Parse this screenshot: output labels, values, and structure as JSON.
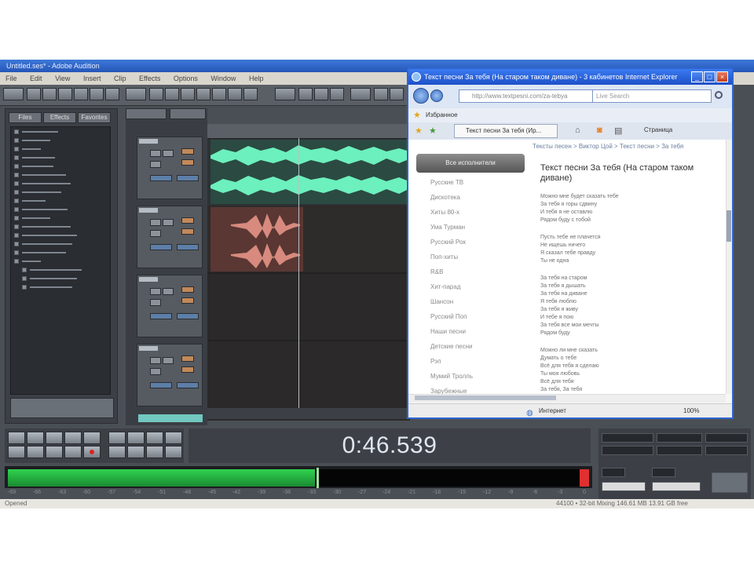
{
  "daw": {
    "title": "Untitled.ses* - Adobe Audition",
    "menu": [
      "File",
      "Edit",
      "View",
      "Insert",
      "Clip",
      "Effects",
      "Options",
      "Window",
      "Help"
    ],
    "organizer_tabs": [
      "Files",
      "Effects",
      "Favorites"
    ],
    "time_display": "0:46.539",
    "status_left": "Opened",
    "status_right": "44100 • 32-bit Mixing   146.61 MB   13.91 GB free",
    "level_scale": [
      "-69",
      "-66",
      "-63",
      "-60",
      "-57",
      "-54",
      "-51",
      "-48",
      "-45",
      "-42",
      "-39",
      "-36",
      "-33",
      "-30",
      "-27",
      "-24",
      "-21",
      "-18",
      "-15",
      "-12",
      "-9",
      "-6",
      "-3",
      "0"
    ],
    "level_fraction": 0.53,
    "colors": {
      "wave_green": "#5fe0b0",
      "wave_red": "#c8685a",
      "level_green": "#2fd24f"
    }
  },
  "browser": {
    "title": "Текст песни За тебя (На старом таком диване) - 3 кабинетов Internet Explorer",
    "address": "http://www.textpesni.com/za-tebya",
    "search_placeholder": "Live Search",
    "favorites_label": "Избранное",
    "tab_title": "Текст песни За тебя (Ир...",
    "page_menu": "Страница",
    "breadcrumb": "Тексты песен > Виктор Цой > Текст песни > За тебя",
    "back_button": "Все исполнители",
    "artists": [
      "Русские ТВ",
      "Дискотека",
      "Хиты 80-х",
      "Ума Турман",
      "Русский Рок",
      "Поп-хиты",
      "R&B",
      "Хит-парад",
      "Шансон",
      "Русский Поп",
      "Наши песни",
      "Детские песни",
      "Рэп",
      "Мумий Тролль",
      "Зарубежные"
    ],
    "song_title": "Текст песни За тебя (На старом таком диване)",
    "lyrics": [
      [
        "Можно мне будет сказать тебе",
        "За тебя я горы сдвину",
        "И тебя я не оставлю",
        "Рядом буду с тобой"
      ],
      [
        "Пусть тебе не плачется",
        "Не ищешь ничего",
        "Я сказал тебе правду",
        "Ты не одна"
      ],
      [
        "За тебя на старом",
        "За тебя я дышать",
        "За тебя на диване",
        "Я тебя люблю",
        "За тебя я живу",
        "И тебе я пою",
        "За тебя все мои мечты",
        "Рядом буду"
      ],
      [
        "Можно ли мне сказать",
        "Думать о тебе",
        "Всё для тебя я сделаю",
        "Ты моя любовь",
        "Всё для тебя",
        "За тебя, За тебя"
      ]
    ],
    "status_zone": "Интернет",
    "zoom": "100%"
  }
}
